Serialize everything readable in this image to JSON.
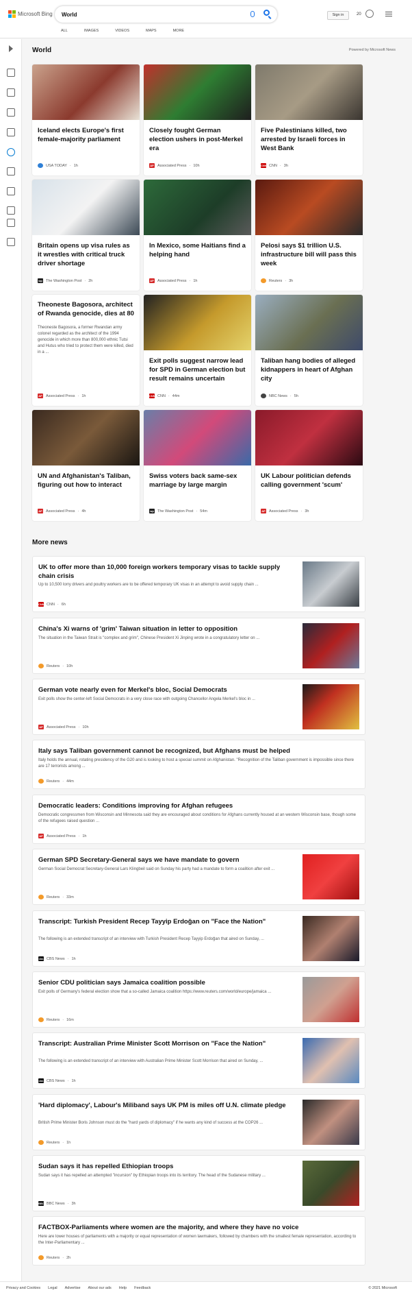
{
  "header": {
    "brand": "Microsoft Bing",
    "query": "World",
    "tabs": [
      "ALL",
      "IMAGES",
      "VIDEOS",
      "MAPS",
      "MORE"
    ],
    "signin": "Sign in",
    "points": "20"
  },
  "section": {
    "title": "World",
    "powered": "Powered by Microsoft News"
  },
  "cards": [
    {
      "title": "Iceland elects Europe's first female-majority parliament",
      "source": "USA TODAY",
      "time": "1h",
      "badge": "",
      "badge_color": "#2f80d6"
    },
    {
      "title": "Closely fought German election ushers in post-Merkel era",
      "source": "Associated Press",
      "time": "10h",
      "badge": "AP",
      "badge_color": "#d52a2a"
    },
    {
      "title": "Five Palestinians killed, two arrested by Israeli forces in West Bank",
      "source": "CNN",
      "time": "3h",
      "badge": "CNN",
      "badge_color": "#cc0000"
    },
    {
      "title": "Britain opens up visa rules as it wrestles with critical truck driver shortage",
      "source": "The Washington Post",
      "time": "2h",
      "badge": "wp",
      "badge_color": "#222"
    },
    {
      "title": "In Mexico, some Haitians find a helping hand",
      "source": "Associated Press",
      "time": "1h",
      "badge": "AP",
      "badge_color": "#d52a2a"
    },
    {
      "title": "Pelosi says $1 trillion U.S. infrastructure bill will pass this week",
      "source": "Reuters",
      "time": "3h",
      "badge": "",
      "badge_color": "#f39a2a"
    },
    {
      "title": "Theoneste Bagosora, architect of Rwanda genocide, dies at 80",
      "summary": "Theoneste Bagosora, a former Rwandan army colonel regarded as the architect of the 1994 genocide in which more than 800,000 ethnic Tutsi and Hutus who tried to protect them were killed, died in a ...",
      "source": "Associated Press",
      "time": "1h",
      "badge": "AP",
      "badge_color": "#d52a2a"
    },
    {
      "title": "Exit polls suggest narrow lead for SPD in German election but result remains uncertain",
      "source": "CNN",
      "time": "44m",
      "badge": "CNN",
      "badge_color": "#cc0000"
    },
    {
      "title": "Taliban hang bodies of alleged kidnappers in heart of Afghan city",
      "source": "NBC News",
      "time": "5h",
      "badge": "",
      "badge_color": "#444"
    },
    {
      "title": "UN and Afghanistan's Taliban, figuring out how to interact",
      "source": "Associated Press",
      "time": "4h",
      "badge": "AP",
      "badge_color": "#d52a2a"
    },
    {
      "title": "Swiss voters back same-sex marriage by large margin",
      "source": "The Washington Post",
      "time": "54m",
      "badge": "wp",
      "badge_color": "#222"
    },
    {
      "title": "UK Labour politician defends calling government 'scum'",
      "source": "Associated Press",
      "time": "3h",
      "badge": "AP",
      "badge_color": "#d52a2a"
    }
  ],
  "more": {
    "title": "More news",
    "items": [
      {
        "title": "UK to offer more than 10,000 foreign workers temporary visas to tackle supply chain crisis",
        "desc": "Up to 10,500 lorry drivers and poultry workers are to be offered temporary UK visas in an attempt to avoid supply chain ...",
        "source": "CNN",
        "time": "6h",
        "badge": "CNN",
        "badge_color": "#cc0000"
      },
      {
        "title": "China's Xi warns of 'grim' Taiwan situation in letter to opposition",
        "desc": "The situation in the Taiwan Strait is \"complex and grim\", Chinese President Xi Jinping wrote in a congratulatory letter on ...",
        "source": "Reuters",
        "time": "10h",
        "badge": "",
        "badge_color": "#f39a2a"
      },
      {
        "title": "German vote nearly even for Merkel's bloc, Social Democrats",
        "desc": "Exit polls show the center-left Social Democrats in a very close race with outgoing Chancellor Angela Merkel's bloc in ...",
        "source": "Associated Press",
        "time": "10h",
        "badge": "AP",
        "badge_color": "#d52a2a"
      },
      {
        "title": "Italy says Taliban government cannot be recognized, but Afghans must be helped",
        "desc": "Italy holds the annual, rotating presidency of the G20 and is looking to host a special summit on Afghanistan. \"Recognition of the Taliban government is impossible since there are 17 terrorists among ...",
        "source": "Reuters",
        "time": "44m",
        "badge": "",
        "badge_color": "#f39a2a"
      },
      {
        "title": "Democratic leaders: Conditions improving for Afghan refugees",
        "desc": "Democratic congressmen from Wisconsin and Minnesota said they are encouraged about conditions for Afghans currently housed at an western Wisconsin base, though some of the refugees raised question ...",
        "source": "Associated Press",
        "time": "1h",
        "badge": "AP",
        "badge_color": "#d52a2a"
      },
      {
        "title": "German SPD Secretary-General says we have mandate to govern",
        "desc": "German Social Democrat Secretary-General Lars Klingbeil said on Sunday his party had a mandate to form a coalition after exit ...",
        "source": "Reuters",
        "time": "33m",
        "badge": "",
        "badge_color": "#f39a2a"
      },
      {
        "title": "Transcript: Turkish President Recep Tayyip Erdoğan on \"Face the Nation\"",
        "desc": "The following is an extended transcript of an interview with Turkish President Recep Tayyip Erdoğan that aired on Sunday, ...",
        "source": "CBS News",
        "time": "1h",
        "badge": "cbs",
        "badge_color": "#111"
      },
      {
        "title": "Senior CDU politician says Jamaica coalition possible",
        "desc": "Exit polls of Germany's federal election show that a so-called Jamaica coalition https://www.reuters.com/world/europe/jamaica ...",
        "source": "Reuters",
        "time": "16m",
        "badge": "",
        "badge_color": "#f39a2a"
      },
      {
        "title": "Transcript: Australian Prime Minister Scott Morrison on \"Face the Nation\"",
        "desc": "The following is an extended transcript of an interview with Australian Prime Minister Scott Morrison that aired on Sunday, ...",
        "source": "CBS News",
        "time": "1h",
        "badge": "cbs",
        "badge_color": "#111"
      },
      {
        "title": "'Hard diplomacy', Labour's Miliband says UK PM is miles off U.N. climate pledge",
        "desc": "British Prime Minister Boris Johnson must do the \"hard yards of diplomacy\" if he wants any kind of success at the COP26 ...",
        "source": "Reuters",
        "time": "1h",
        "badge": "",
        "badge_color": "#f39a2a"
      },
      {
        "title": "Sudan says it has repelled Ethiopian troops",
        "desc": "Sudan says it has repelled an attempted \"incursion\" by Ethiopian troops into its territory. The head of the Sudanese military ...",
        "source": "BBC News",
        "time": "3h",
        "badge": "BBC",
        "badge_color": "#111"
      },
      {
        "title": "FACTBOX-Parliaments where women are the majority, and where they have no voice",
        "desc": "Here are lower houses of parliaments with a majority or equal representation of women lawmakers, followed by chambers with the smallest female representation, according to the Inter-Parliamentary ...",
        "source": "Reuters",
        "time": "2h",
        "badge": "",
        "badge_color": "#f39a2a"
      }
    ]
  },
  "footer": {
    "links": [
      "Privacy and Cookies",
      "Legal",
      "Advertise",
      "About our ads",
      "Help",
      "Feedback"
    ],
    "copyright": "© 2021 Microsoft"
  }
}
